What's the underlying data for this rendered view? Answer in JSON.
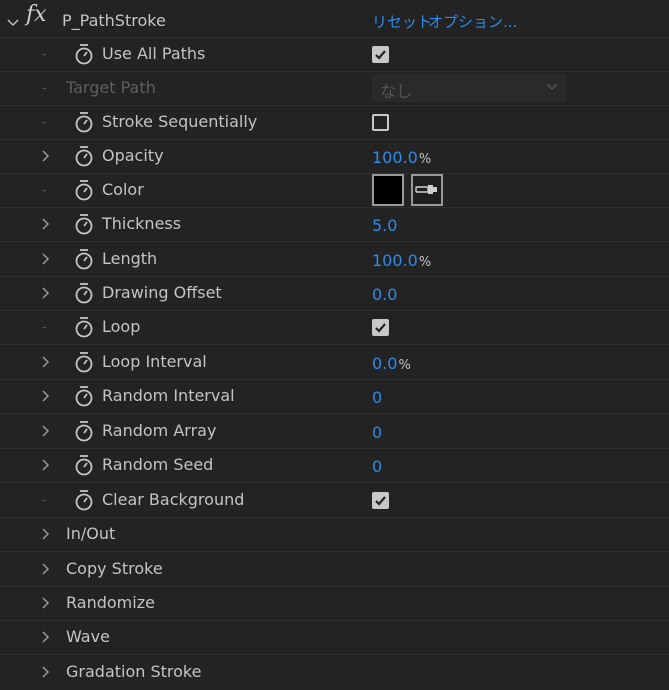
{
  "effect": {
    "fx_symbol": "fx",
    "name": "P_PathStroke",
    "reset_label": "リセット",
    "options_label": "オプション..."
  },
  "params": {
    "use_all_paths": {
      "label": "Use All Paths",
      "checked": true
    },
    "target_path": {
      "label": "Target Path",
      "value": "なし"
    },
    "stroke_sequentially": {
      "label": "Stroke Sequentially",
      "checked": false
    },
    "opacity": {
      "label": "Opacity",
      "value": "100.0",
      "unit": "%"
    },
    "color": {
      "label": "Color",
      "value": "#000000"
    },
    "thickness": {
      "label": "Thickness",
      "value": "5.0"
    },
    "length": {
      "label": "Length",
      "value": "100.0",
      "unit": "%"
    },
    "drawing_offset": {
      "label": "Drawing Offset",
      "value": "0.0"
    },
    "loop": {
      "label": "Loop",
      "checked": true
    },
    "loop_interval": {
      "label": "Loop Interval",
      "value": "0.0",
      "unit": "%"
    },
    "random_interval": {
      "label": "Random Interval",
      "value": "0"
    },
    "random_array": {
      "label": "Random Array",
      "value": "0"
    },
    "random_seed": {
      "label": "Random Seed",
      "value": "0"
    },
    "clear_background": {
      "label": "Clear Background",
      "checked": true
    }
  },
  "groups": [
    "In/Out",
    "Copy Stroke",
    "Randomize",
    "Wave",
    "Gradation Stroke"
  ],
  "colors": {
    "accent": "#2d8ceb",
    "background": "#232323"
  }
}
